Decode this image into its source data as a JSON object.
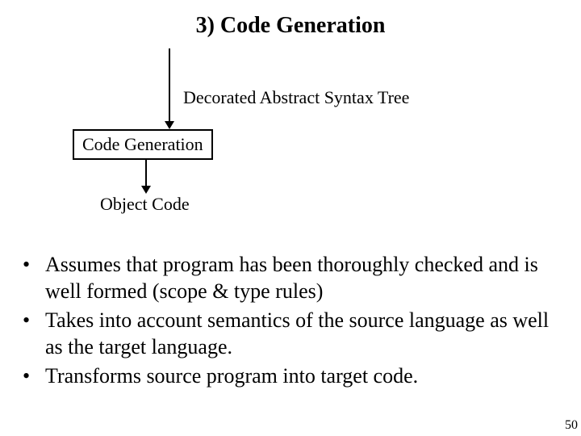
{
  "title": "3) Code Generation",
  "diagram": {
    "input_label": "Decorated Abstract Syntax Tree",
    "box_label": "Code Generation",
    "output_label": "Object Code"
  },
  "bullets": [
    "Assumes that program has been thoroughly checked and is well formed (scope & type rules)",
    "Takes into account semantics of the source language as well as the target language.",
    "Transforms source program into target code."
  ],
  "page_number": "50"
}
